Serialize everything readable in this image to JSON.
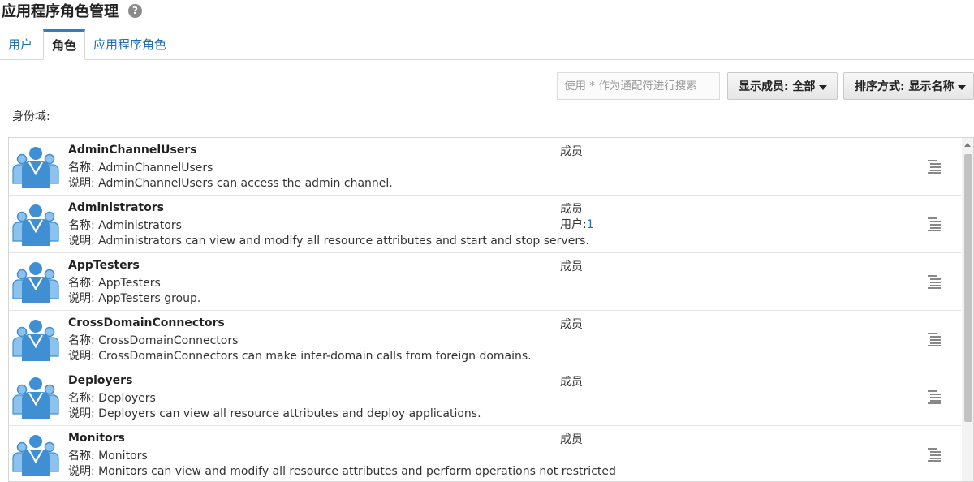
{
  "header": {
    "title": "应用程序角色管理",
    "help_icon": "?"
  },
  "tabs": [
    {
      "label": "用户",
      "active": false
    },
    {
      "label": "角色",
      "active": true
    },
    {
      "label": "应用程序角色",
      "active": false
    }
  ],
  "toolbar": {
    "search_placeholder": "使用 * 作为通配符进行搜索",
    "show_members_label": "显示成员: 全部",
    "sort_label": "排序方式: 显示名称"
  },
  "domain_label": "身份域:",
  "roles": [
    {
      "title": "AdminChannelUsers",
      "name_line": "名称: AdminChannelUsers",
      "desc_line": "说明: AdminChannelUsers can access the admin channel.",
      "members_header": "成员",
      "users_label": "",
      "users_count": ""
    },
    {
      "title": "Administrators",
      "name_line": "名称: Administrators",
      "desc_line": "说明: Administrators can view and modify all resource attributes and start and stop servers.",
      "members_header": "成员",
      "users_label": "用户:",
      "users_count": "1"
    },
    {
      "title": "AppTesters",
      "name_line": "名称: AppTesters",
      "desc_line": "说明: AppTesters group.",
      "members_header": "成员",
      "users_label": "",
      "users_count": ""
    },
    {
      "title": "CrossDomainConnectors",
      "name_line": "名称: CrossDomainConnectors",
      "desc_line": "说明: CrossDomainConnectors can make inter-domain calls from foreign domains.",
      "members_header": "成员",
      "users_label": "",
      "users_count": ""
    },
    {
      "title": "Deployers",
      "name_line": "名称: Deployers",
      "desc_line": "说明: Deployers can view all resource attributes and deploy applications.",
      "members_header": "成员",
      "users_label": "",
      "users_count": ""
    },
    {
      "title": "Monitors",
      "name_line": "名称: Monitors",
      "desc_line": "说明: Monitors can view and modify all resource attributes and perform operations not restricted",
      "members_header": "成员",
      "users_label": "",
      "users_count": ""
    }
  ],
  "colors": {
    "accent": "#1f6fb2",
    "icon_blue": "#3f8fd2",
    "icon_light": "#8cc2ee"
  },
  "icons": {
    "role": "group-users-icon",
    "row_menu": "list-menu-icon"
  }
}
